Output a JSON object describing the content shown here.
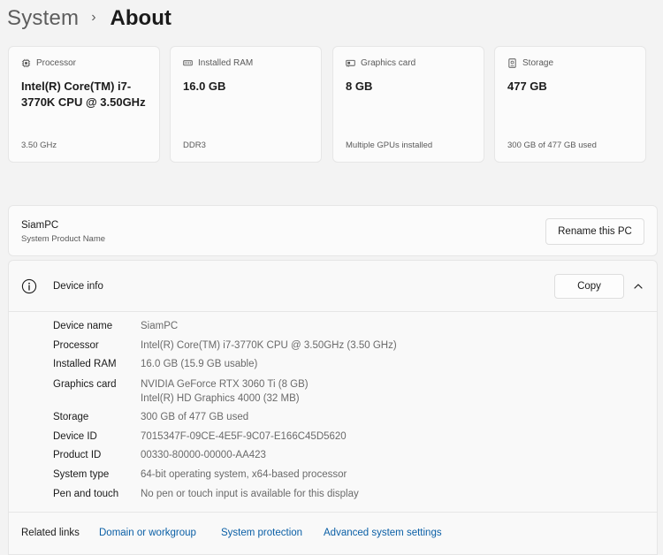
{
  "breadcrumb": {
    "parent": "System",
    "separator": "›",
    "current": "About"
  },
  "cards": [
    {
      "label": "Processor",
      "icon": "processor-icon",
      "value": "Intel(R) Core(TM) i7-3770K CPU @ 3.50GHz",
      "sub": "3.50 GHz"
    },
    {
      "label": "Installed RAM",
      "icon": "ram-icon",
      "value": "16.0 GB",
      "sub": "DDR3"
    },
    {
      "label": "Graphics card",
      "icon": "graphics-card-icon",
      "value": "8 GB",
      "sub": "Multiple GPUs installed"
    },
    {
      "label": "Storage",
      "icon": "storage-icon",
      "value": "477 GB",
      "sub": "300 GB of 477 GB used"
    }
  ],
  "pc": {
    "name": "SiamPC",
    "subtitle": "System Product Name",
    "rename_label": "Rename this PC"
  },
  "device_info": {
    "title": "Device info",
    "copy_label": "Copy",
    "specs": [
      {
        "key": "Device name",
        "value": "SiamPC"
      },
      {
        "key": "Processor",
        "value": "Intel(R) Core(TM) i7-3770K CPU @ 3.50GHz (3.50 GHz)"
      },
      {
        "key": "Installed RAM",
        "value": "16.0 GB (15.9 GB usable)"
      },
      {
        "key": "Graphics card",
        "value": "NVIDIA GeForce RTX 3060 Ti (8 GB)",
        "value2": "Intel(R) HD Graphics 4000 (32 MB)"
      },
      {
        "key": "Storage",
        "value": "300 GB of 477 GB used"
      },
      {
        "key": "Device ID",
        "value": "7015347F-09CE-4E5F-9C07-E166C45D5620"
      },
      {
        "key": "Product ID",
        "value": "00330-80000-00000-AA423"
      },
      {
        "key": "System type",
        "value": "64-bit operating system, x64-based processor"
      },
      {
        "key": "Pen and touch",
        "value": "No pen or touch input is available for this display"
      }
    ]
  },
  "related": {
    "label": "Related links",
    "links": [
      "Domain or workgroup",
      "System protection",
      "Advanced system settings"
    ]
  },
  "colors": {
    "link": "#0a5fa6",
    "background": "#f3f3f3",
    "card": "#fbfbfb"
  }
}
